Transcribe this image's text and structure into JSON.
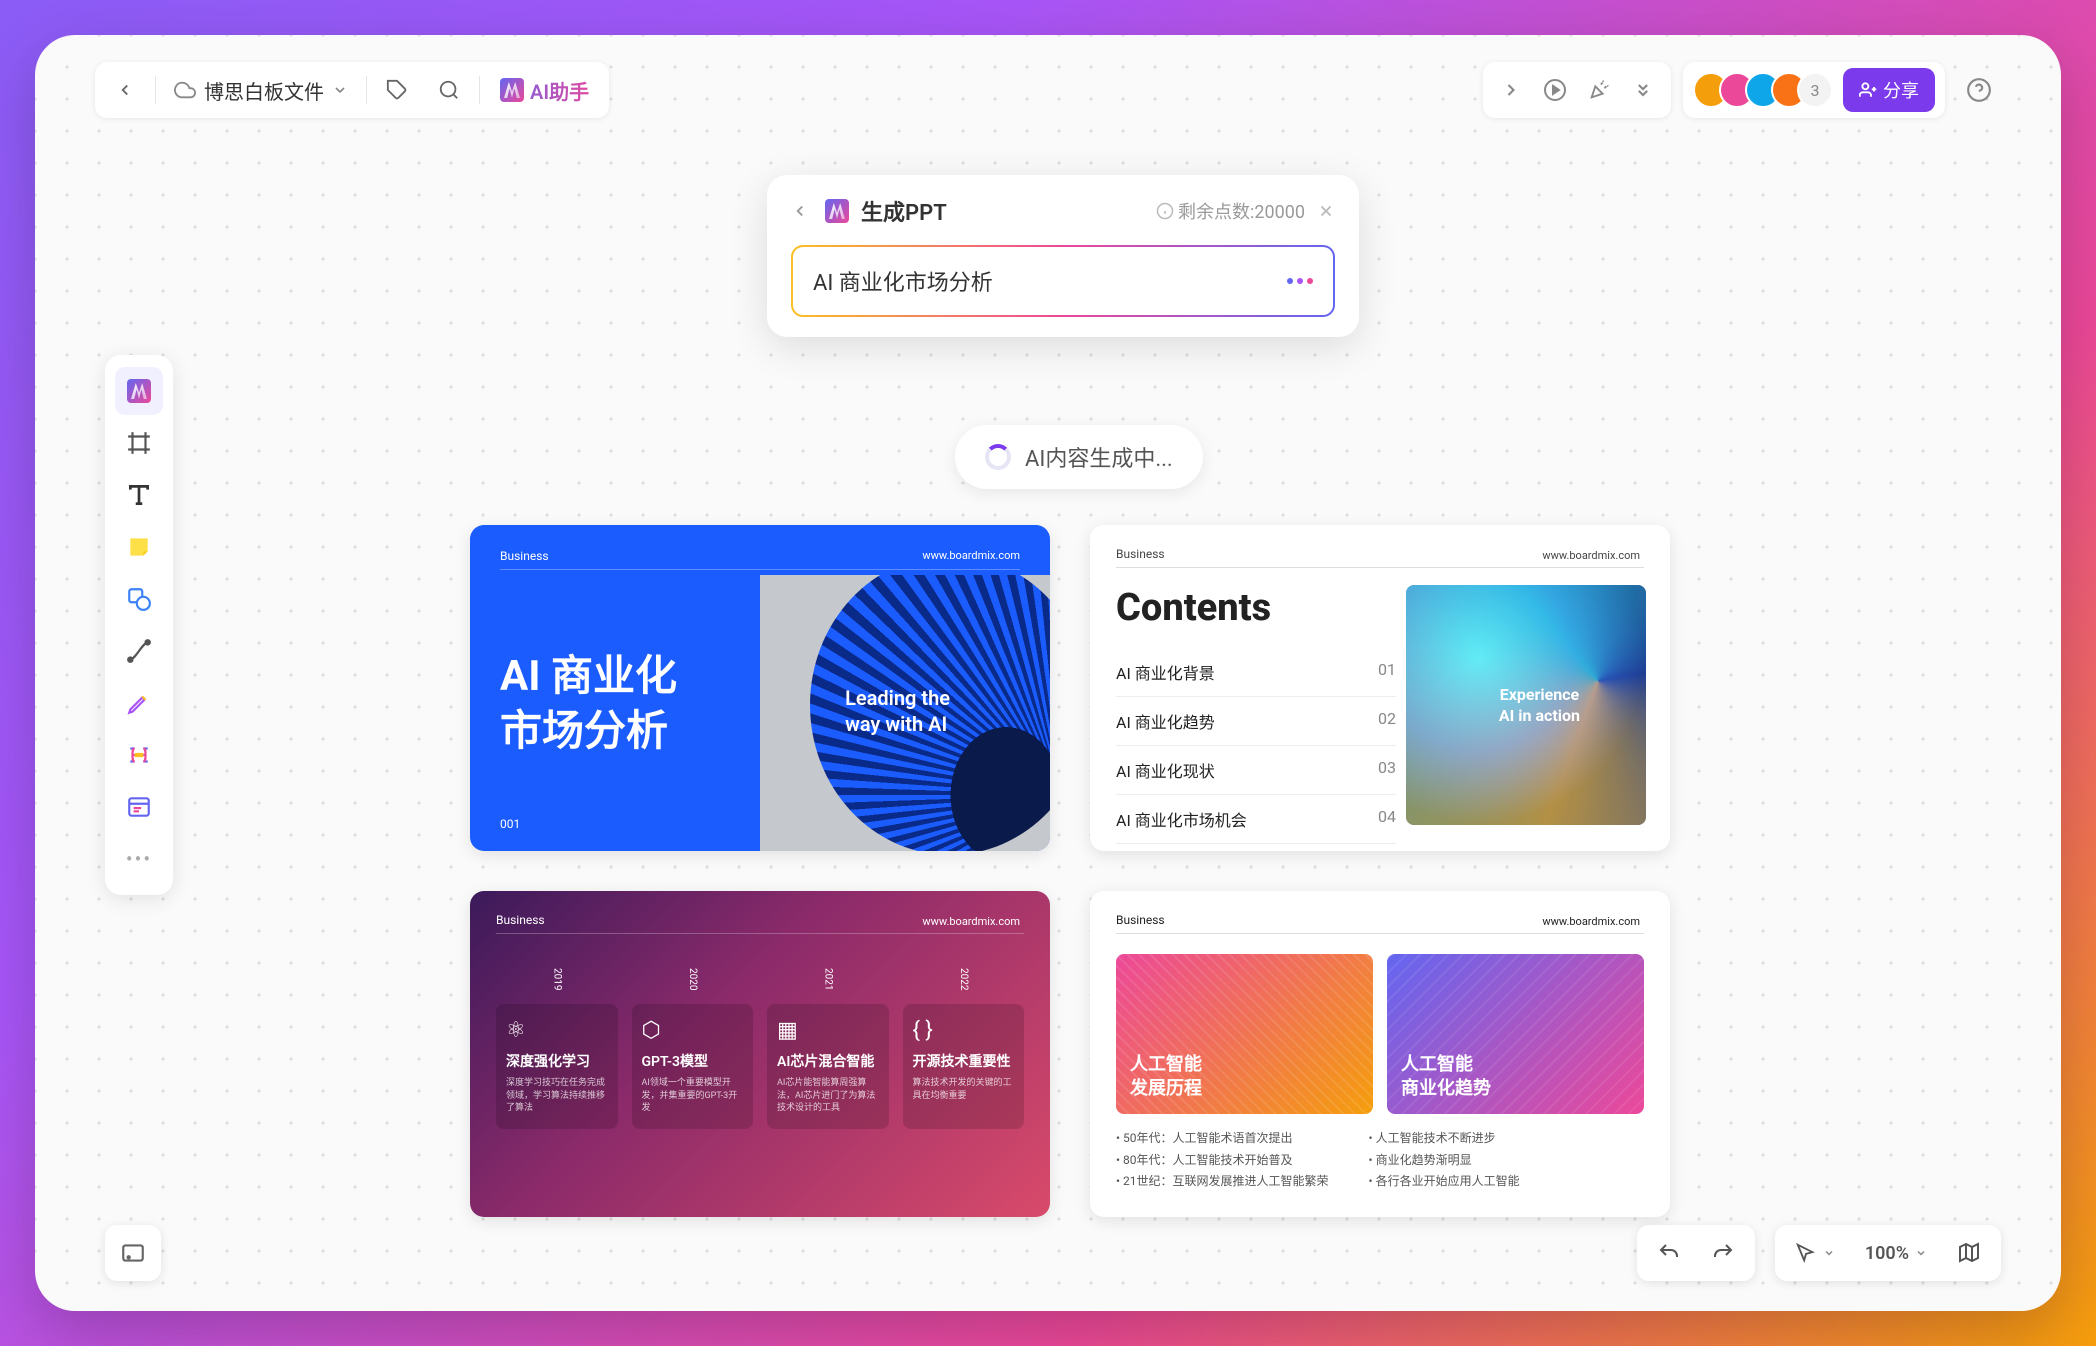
{
  "topbar": {
    "file_name": "博思白板文件",
    "ai_assist_label": "AI助手"
  },
  "avatars": {
    "extra_count": "3",
    "colors": [
      "#f59e0b",
      "#ec4899",
      "#0ea5e9",
      "#f97316"
    ]
  },
  "share_label": "分享",
  "ai_panel": {
    "title": "生成PPT",
    "points_label": "剩余点数:20000",
    "input_text": "AI 商业化市场分析"
  },
  "generating_label": "AI内容生成中...",
  "slides": {
    "slide1": {
      "tag": "Business",
      "url": "www.boardmix.com",
      "title_line1": "AI 商业化",
      "title_line2": "市场分析",
      "subtitle_line1": "Leading the",
      "subtitle_line2": "way with AI",
      "number": "001"
    },
    "slide2": {
      "tag": "Business",
      "url": "www.boardmix.com",
      "title": "Contents",
      "items": [
        {
          "label": "AI 商业化背景",
          "num": "01"
        },
        {
          "label": "AI 商业化趋势",
          "num": "02"
        },
        {
          "label": "AI 商业化现状",
          "num": "03"
        },
        {
          "label": "AI 商业化市场机会",
          "num": "04"
        }
      ],
      "art_sub_line1": "Experience",
      "art_sub_line2": "AI in action"
    },
    "slide3": {
      "tag": "Business",
      "url": "www.boardmix.com",
      "cols": [
        {
          "year": "2019",
          "label": "深度强化学习",
          "desc": "深度学习技巧在任务完成领域，学习算法持续推移了算法"
        },
        {
          "year": "2020",
          "label": "GPT-3模型",
          "desc": "AI领域一个重要模型开发，并集重要的GPT-3开发"
        },
        {
          "year": "2021",
          "label": "AI芯片混合智能",
          "desc": "AI芯片能智能算周强算法，AI芯片进门了为算法技术设计的工具"
        },
        {
          "year": "2022",
          "label": "开源技术重要性",
          "desc": "算法技术开发的关键的工具在均衡重要"
        }
      ]
    },
    "slide4": {
      "tag": "Business",
      "url": "www.boardmix.com",
      "blocks": [
        {
          "title_line1": "人工智能",
          "title_line2": "发展历程"
        },
        {
          "title_line1": "人工智能",
          "title_line2": "商业化趋势"
        }
      ],
      "bullets_left": [
        "50年代：人工智能术语首次提出",
        "80年代：人工智能技术开始普及",
        "21世纪：互联网发展推进人工智能繁荣"
      ],
      "bullets_right": [
        "人工智能技术不断进步",
        "商业化趋势渐明显",
        "各行各业开始应用人工智能"
      ]
    }
  },
  "zoom": "100%"
}
